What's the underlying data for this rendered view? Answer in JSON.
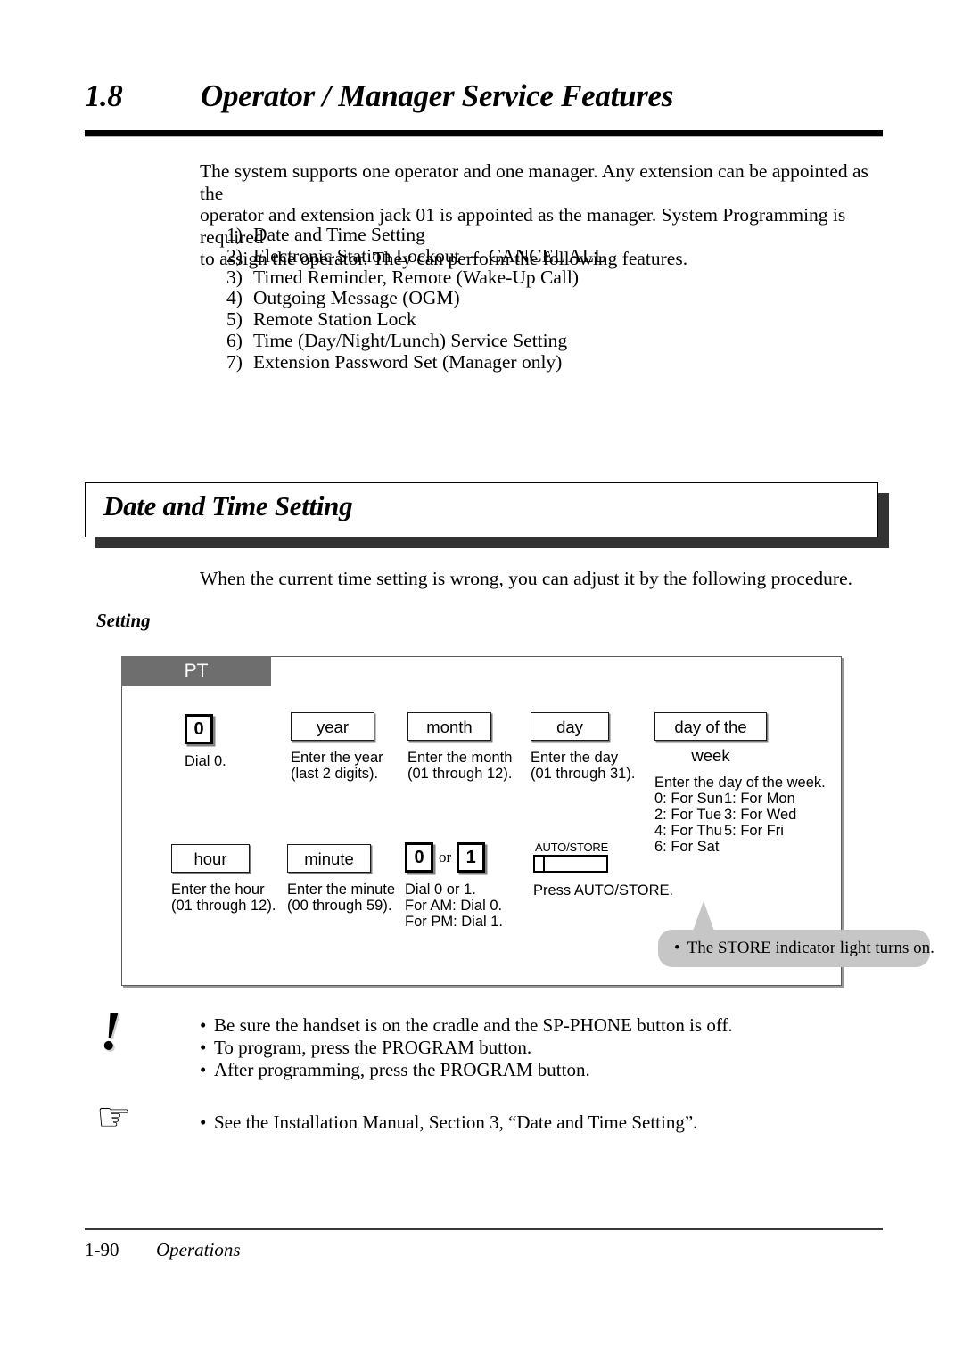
{
  "header": {
    "section_number": "1.8",
    "section_title": "Operator / Manager Service Features"
  },
  "intro": {
    "line1": "The system supports one operator and one manager. Any extension can be appointed as the",
    "line2": "operator and extension jack 01 is appointed as the manager. System Programming is required",
    "line3": "to assign the operator. They can perform the following features."
  },
  "feature_list": [
    {
      "n": "1)",
      "label": "Date and Time Setting"
    },
    {
      "n": "2)",
      "label": "Electronic Station Lockout — CANCEL ALL"
    },
    {
      "n": "3)",
      "label": "Timed Reminder, Remote (Wake-Up Call)"
    },
    {
      "n": "4)",
      "label": "Outgoing Message (OGM)"
    },
    {
      "n": "5)",
      "label": "Remote Station Lock"
    },
    {
      "n": "6)",
      "label": "Time (Day/Night/Lunch) Service Setting"
    },
    {
      "n": "7)",
      "label": "Extension Password Set (Manager only)"
    }
  ],
  "feature_heading": "Date and Time Setting",
  "lead_in": "When the current time setting is wrong, you can adjust it by the following procedure.",
  "setting_label": "Setting",
  "diagram": {
    "tab_label": "PT",
    "row1": [
      {
        "key_type": "dial",
        "key_label": "0",
        "caption": "Dial 0."
      },
      {
        "key_type": "box",
        "key_label": "year",
        "caption": "Enter the year\n(last 2 digits)."
      },
      {
        "key_type": "box",
        "key_label": "month",
        "caption": "Enter the month\n(01 through 12)."
      },
      {
        "key_type": "box",
        "key_label": "day",
        "caption": "Enter the day\n(01 through 31)."
      },
      {
        "key_type": "box",
        "key_label": "day of the week",
        "caption": "Enter the day of the week."
      }
    ],
    "day_of_week_table": [
      {
        "left": "0: For Sun",
        "right": "1: For Mon"
      },
      {
        "left": "2: For Tue",
        "right": "3: For Wed"
      },
      {
        "left": "4: For Thu",
        "right": "5: For Fri"
      },
      {
        "left": "6: For Sat",
        "right": ""
      }
    ],
    "row2": [
      {
        "key_type": "box",
        "key_label": "hour",
        "caption": "Enter the hour\n(01 through 12)."
      },
      {
        "key_type": "box",
        "key_label": "minute",
        "caption": "Enter the minute\n(00 through 59)."
      }
    ],
    "ampm": {
      "key_0": "0",
      "or": "or",
      "key_1": "1",
      "caption": "Dial 0 or 1.\nFor AM: Dial 0.\nFor PM: Dial 1."
    },
    "autostore": {
      "key_label": "AUTO/STORE",
      "caption": "Press AUTO/STORE."
    },
    "callout": {
      "bullet": "•",
      "text": "The STORE indicator light turns on."
    }
  },
  "notes": {
    "warning_icon": "!",
    "warning_items": [
      "Be sure the handset is on the cradle and the SP-PHONE button is off.",
      "To program, press the PROGRAM button.",
      "After programming, press the PROGRAM button."
    ],
    "reference_icon": "☞",
    "reference_items": [
      "See the Installation Manual, Section 3, “Date and Time Setting”."
    ],
    "bullet": "•"
  },
  "footer": {
    "page_number": "1-90",
    "section_name": "Operations"
  }
}
